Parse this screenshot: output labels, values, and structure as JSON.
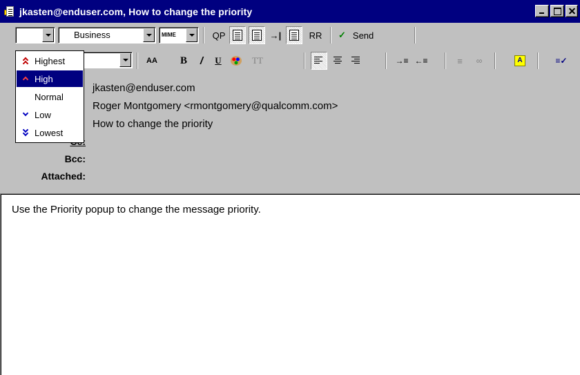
{
  "window": {
    "title": "jkasten@enduser.com, How to change the priority"
  },
  "toolbar1": {
    "signature_value": "Business",
    "mime_label": "MIME",
    "qp_label": "QP",
    "rr_label": "RR",
    "send_label": "Send"
  },
  "priority_menu": {
    "items": [
      {
        "label": "Highest",
        "icon": "double-up-chevron-icon",
        "color": "#c00000"
      },
      {
        "label": "High",
        "icon": "up-chevron-icon",
        "color": "#c00000"
      },
      {
        "label": "Normal",
        "icon": "",
        "color": ""
      },
      {
        "label": "Low",
        "icon": "down-chevron-icon",
        "color": "#0000c0"
      },
      {
        "label": "Lowest",
        "icon": "double-down-chevron-icon",
        "color": "#0000c0"
      }
    ],
    "selected": "High"
  },
  "toolbar2": {
    "font_size_label": "AA",
    "bold_label": "B",
    "italic_label": "/",
    "underline_label": "U",
    "teletype_label": "TT"
  },
  "header": {
    "to_value": "jkasten@enduser.com",
    "from_value": "Roger Montgomery <rmontgomery@qualcomm.com>",
    "subject_value": "How to change the priority",
    "cc_label": "Cc:",
    "bcc_label": "Bcc:",
    "attached_label": "Attached:"
  },
  "body": {
    "text": "Use the Priority popup to change the message priority."
  },
  "colors": {
    "titlebar": "#000080",
    "selection": "#000080",
    "chrome": "#c0c0c0"
  }
}
